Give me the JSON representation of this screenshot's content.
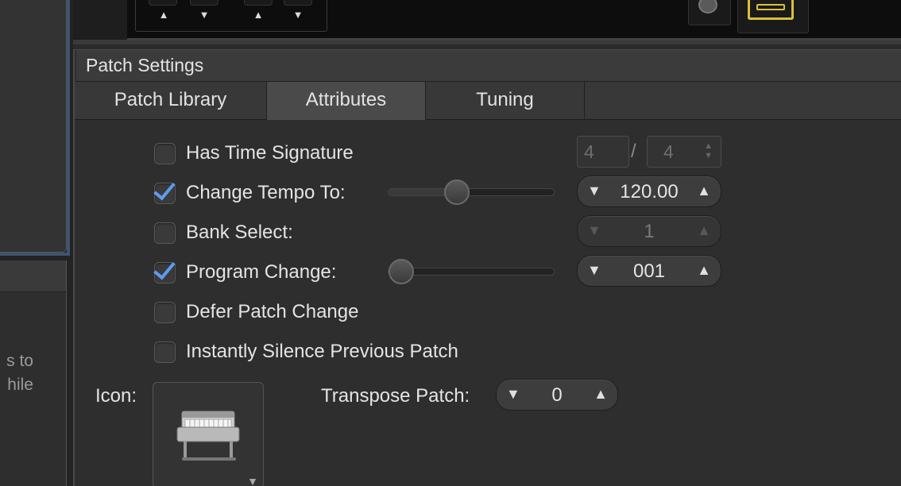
{
  "left": {
    "fragment_text": "s to\nhile"
  },
  "topbar": {
    "arrow_up": "▲",
    "arrow_down": "▼"
  },
  "panel": {
    "title": "Patch Settings",
    "tabs": [
      {
        "label": "Patch Library",
        "active": false
      },
      {
        "label": "Attributes",
        "active": true
      },
      {
        "label": "Tuning",
        "active": false
      }
    ],
    "time_signature": {
      "label": "Has Time Signature",
      "checked": false,
      "numerator": "4",
      "slash": "/",
      "denominator": "4"
    },
    "change_tempo": {
      "label": "Change Tempo To:",
      "checked": true,
      "value": "120.00",
      "slider_fraction": 0.4
    },
    "bank_select": {
      "label": "Bank Select:",
      "checked": false,
      "value": "1"
    },
    "program_change": {
      "label": "Program Change:",
      "checked": true,
      "value": "001",
      "slider_fraction": 0.0
    },
    "defer_patch_change": {
      "label": "Defer Patch Change",
      "checked": false
    },
    "instantly_silence": {
      "label": "Instantly Silence Previous Patch",
      "checked": false
    },
    "icon": {
      "label": "Icon:",
      "icon_name": "electric-piano-icon"
    },
    "transpose": {
      "label": "Transpose Patch:",
      "value": "0"
    }
  },
  "stepper_glyphs": {
    "down": "▼",
    "up": "▲"
  },
  "colors": {
    "accent_blue": "#5b9cf0",
    "yellow": "#d8c13a"
  }
}
